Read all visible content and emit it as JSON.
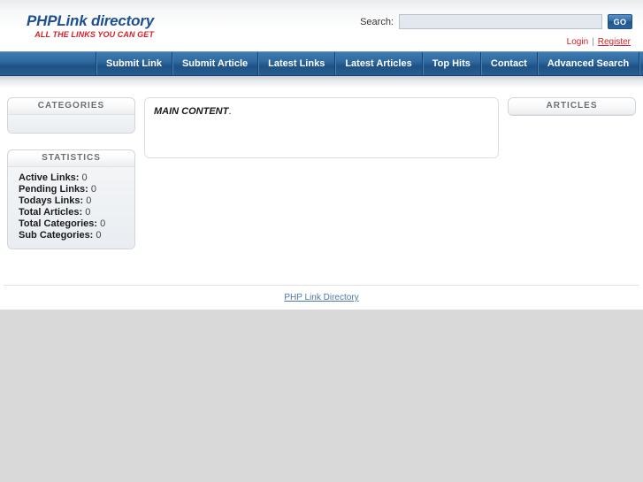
{
  "header": {
    "logo_main": "PHPLink directory",
    "logo_tagline": "ALL THE LINKS YOU CAN GET",
    "search_label": "Search:",
    "search_value": "",
    "search_placeholder": "",
    "go_label": "GO",
    "login_label": "Login",
    "separator": "|",
    "register_label": "Register"
  },
  "nav": {
    "items": [
      {
        "label": "Submit Link"
      },
      {
        "label": "Submit Article"
      },
      {
        "label": "Latest Links"
      },
      {
        "label": "Latest Articles"
      },
      {
        "label": "Top Hits"
      },
      {
        "label": "Contact"
      },
      {
        "label": "Advanced Search"
      }
    ]
  },
  "sidebar_left": {
    "categories": {
      "title": "CATEGORIES",
      "items": []
    },
    "statistics": {
      "title": "STATISTICS",
      "rows": [
        {
          "label": "Active Links:",
          "value": "0"
        },
        {
          "label": "Pending Links:",
          "value": "0"
        },
        {
          "label": "Todays Links:",
          "value": "0"
        },
        {
          "label": "Total Articles:",
          "value": "0"
        },
        {
          "label": "Total Categories:",
          "value": "0"
        },
        {
          "label": "Sub Categories:",
          "value": "0"
        }
      ]
    }
  },
  "main": {
    "content_bold": "MAIN CONTENT",
    "content_rest": "."
  },
  "sidebar_right": {
    "articles": {
      "title": "ARTICLES",
      "items": []
    }
  },
  "footer": {
    "link_label": "PHP Link Directory"
  },
  "colors": {
    "brand_blue": "#1d4f91",
    "brand_red": "#d3202a",
    "nav_blue": "#2f6aa0",
    "panel_gray": "#6b6f73",
    "footer_link": "#4a77a8",
    "page_background": "#d9d9d9"
  }
}
